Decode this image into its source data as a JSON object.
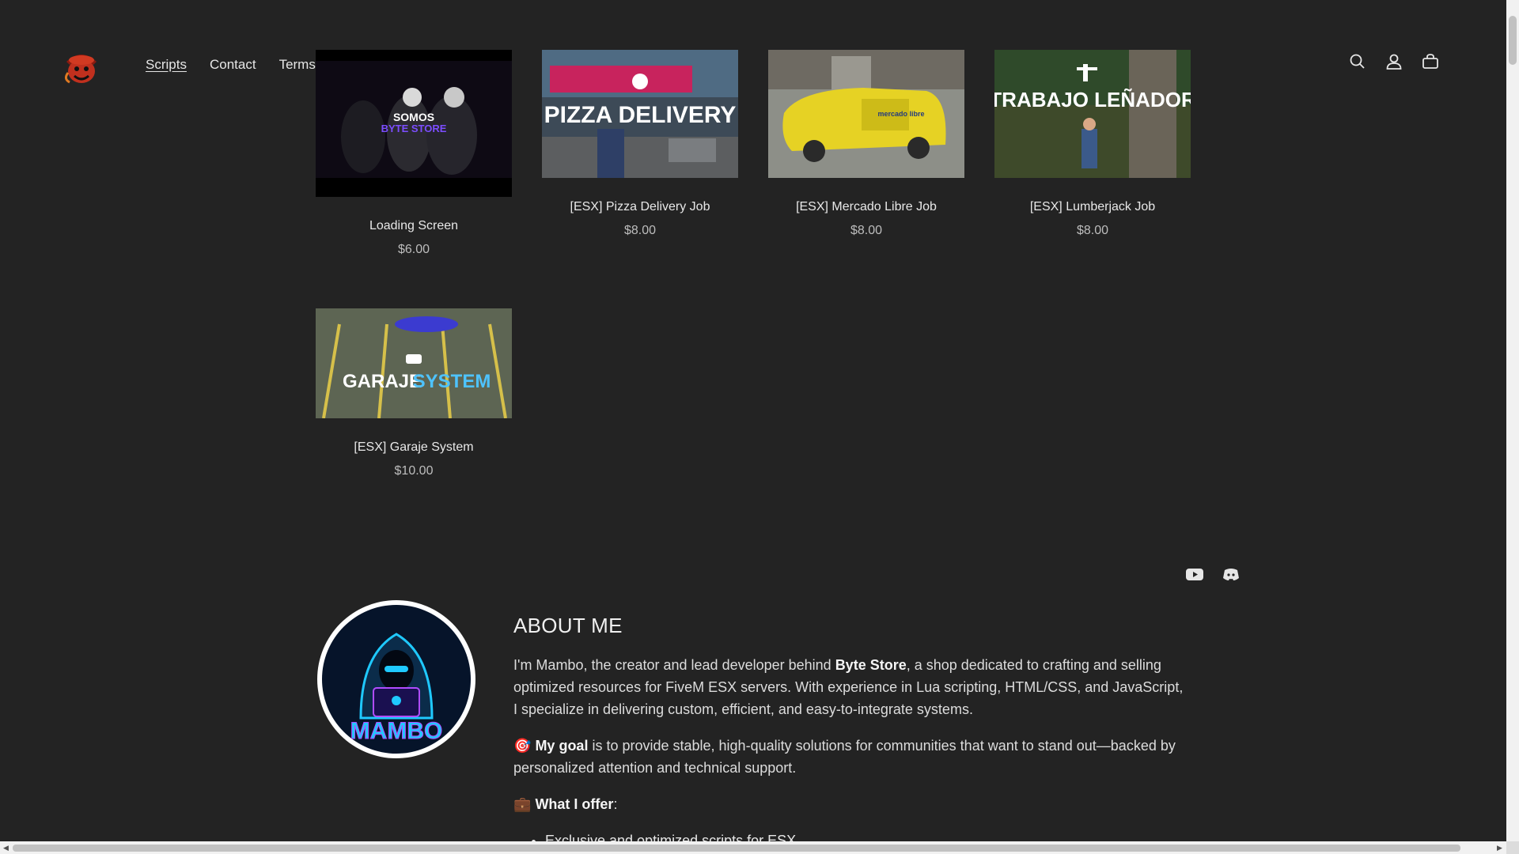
{
  "header": {
    "logo_icon": "pirate-mascot-icon",
    "nav": [
      {
        "label": "Scripts",
        "active": true
      },
      {
        "label": "Contact",
        "active": false
      },
      {
        "label": "Terms",
        "active": false
      }
    ],
    "icons": [
      "search-icon",
      "account-icon",
      "cart-icon"
    ]
  },
  "products": [
    {
      "title": "Loading Screen",
      "price": "$6.00",
      "thumb_text": [
        "SOMOS",
        "BYTE STORE"
      ]
    },
    {
      "title": "[ESX] Pizza Delivery Job",
      "price": "$8.00",
      "thumb_text": [
        "PIZZA DELIVERY"
      ]
    },
    {
      "title": "[ESX] Mercado Libre Job",
      "price": "$8.00",
      "thumb_text": [
        "mercado libre"
      ]
    },
    {
      "title": "[ESX] Lumberjack Job",
      "price": "$8.00",
      "thumb_text": [
        "TRABAJO LEÑADOR"
      ]
    },
    {
      "title": "[ESX] Garaje System",
      "price": "$10.00",
      "thumb_text": [
        "GARAJE",
        "SYSTEM"
      ]
    }
  ],
  "socials": [
    "youtube-icon",
    "discord-icon"
  ],
  "about": {
    "heading": "ABOUT ME",
    "avatar_text": "MAMBO",
    "p1_pre": "I'm Mambo, the creator and lead developer behind ",
    "p1_bold": "Byte Store",
    "p1_post": ", a shop dedicated to crafting and selling optimized resources for FiveM ESX servers. With experience in Lua scripting, HTML/CSS, and JavaScript, I specialize in delivering custom, efficient, and easy-to-integrate systems.",
    "p2_emoji": "🎯",
    "p2_bold": "My goal",
    "p2_post": " is to provide stable, high-quality solutions for communities that want to stand out—backed by personalized attention and technical support.",
    "p3_emoji": "💼",
    "p3_bold": "What I offer",
    "p3_post": ":",
    "list": [
      "Exclusive and optimized scripts for ESX"
    ]
  },
  "colors": {
    "background": "#232323",
    "text": "#e6e6e6"
  }
}
